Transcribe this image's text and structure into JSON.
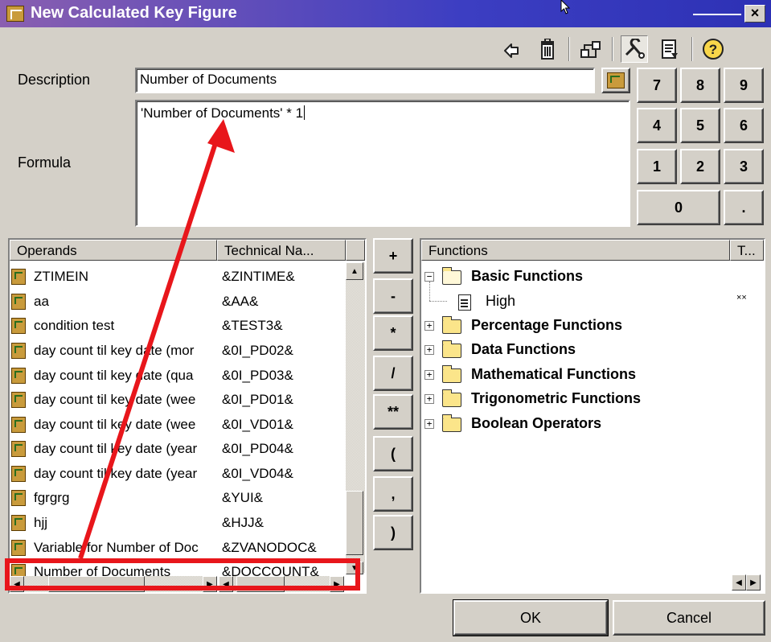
{
  "window": {
    "title": "New Calculated Key Figure",
    "close_glyph": "×"
  },
  "toolbar": {
    "icons": [
      "undo-icon",
      "delete-icon",
      "hierarchy-icon",
      "tools-icon",
      "properties-icon",
      "help-icon"
    ]
  },
  "description": {
    "label": "Description",
    "value": "Number of Documents"
  },
  "formula": {
    "label": "Formula",
    "value": "'Number of Documents' * 1"
  },
  "keypad": {
    "keys": [
      "7",
      "8",
      "9",
      "4",
      "5",
      "6",
      "1",
      "2",
      "3",
      "0",
      "."
    ]
  },
  "operators": [
    "+",
    "-",
    "*",
    "/",
    "**",
    "(",
    ",",
    ")"
  ],
  "operands": {
    "columns": [
      "Operands",
      "Technical Na..."
    ],
    "rows": [
      {
        "name": "ZTIMEIN",
        "tech": "&ZINTIME&"
      },
      {
        "name": "aa",
        "tech": "&AA&"
      },
      {
        "name": "condition test",
        "tech": "&TEST3&"
      },
      {
        "name": "day count til key date (mor",
        "tech": "&0I_PD02&"
      },
      {
        "name": "day count til key date (qua",
        "tech": "&0I_PD03&"
      },
      {
        "name": "day count til key date (wee",
        "tech": "&0I_PD01&"
      },
      {
        "name": "day count til key date (wee",
        "tech": "&0I_VD01&"
      },
      {
        "name": "day count til key date (year",
        "tech": "&0I_PD04&"
      },
      {
        "name": "day count til key date (year",
        "tech": "&0I_VD04&"
      },
      {
        "name": "fgrgrg",
        "tech": "&YUI&"
      },
      {
        "name": "hjj",
        "tech": "&HJJ&"
      },
      {
        "name": "Variable for Number of Doc",
        "tech": "&ZVANODOC&"
      },
      {
        "name": "Number of Documents",
        "tech": "&DOCCOUNT&"
      }
    ]
  },
  "functions": {
    "columns": [
      "Functions",
      "T..."
    ],
    "items": [
      {
        "label": "Basic Functions",
        "expanded": true,
        "toggle": "−"
      },
      {
        "label": "High",
        "extra": "××"
      },
      {
        "label": "Percentage Functions",
        "toggle": "+"
      },
      {
        "label": "Data Functions",
        "toggle": "+"
      },
      {
        "label": "Mathematical Functions",
        "toggle": "+"
      },
      {
        "label": "Trigonometric Functions",
        "toggle": "+"
      },
      {
        "label": "Boolean Operators",
        "toggle": "+"
      }
    ]
  },
  "buttons": {
    "ok": "OK",
    "cancel": "Cancel"
  },
  "annotation_color": "#e8161b"
}
